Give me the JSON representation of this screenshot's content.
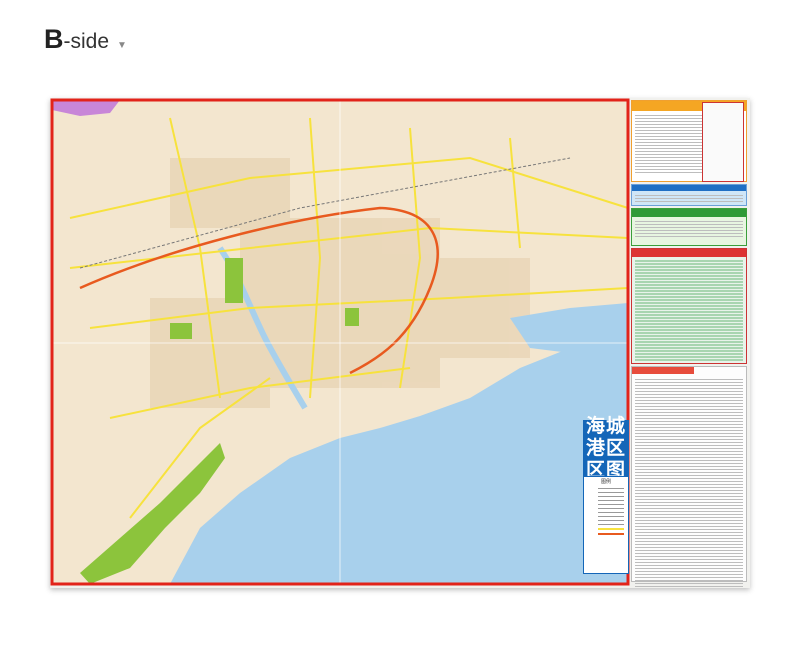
{
  "header": {
    "letter": "B",
    "suffix": "-side",
    "arrow": "▼"
  },
  "map": {
    "title_rows": [
      "海城",
      "港区",
      "区图"
    ],
    "legend_title": "图例",
    "colors": {
      "land": "#f3e6cf",
      "sea": "#a8d0ec",
      "park": "#8cc43c",
      "border": "#e2231a",
      "main_road": "#f7e23d",
      "ring_road": "#e85a1f",
      "title_bg": "#1466b8"
    }
  }
}
